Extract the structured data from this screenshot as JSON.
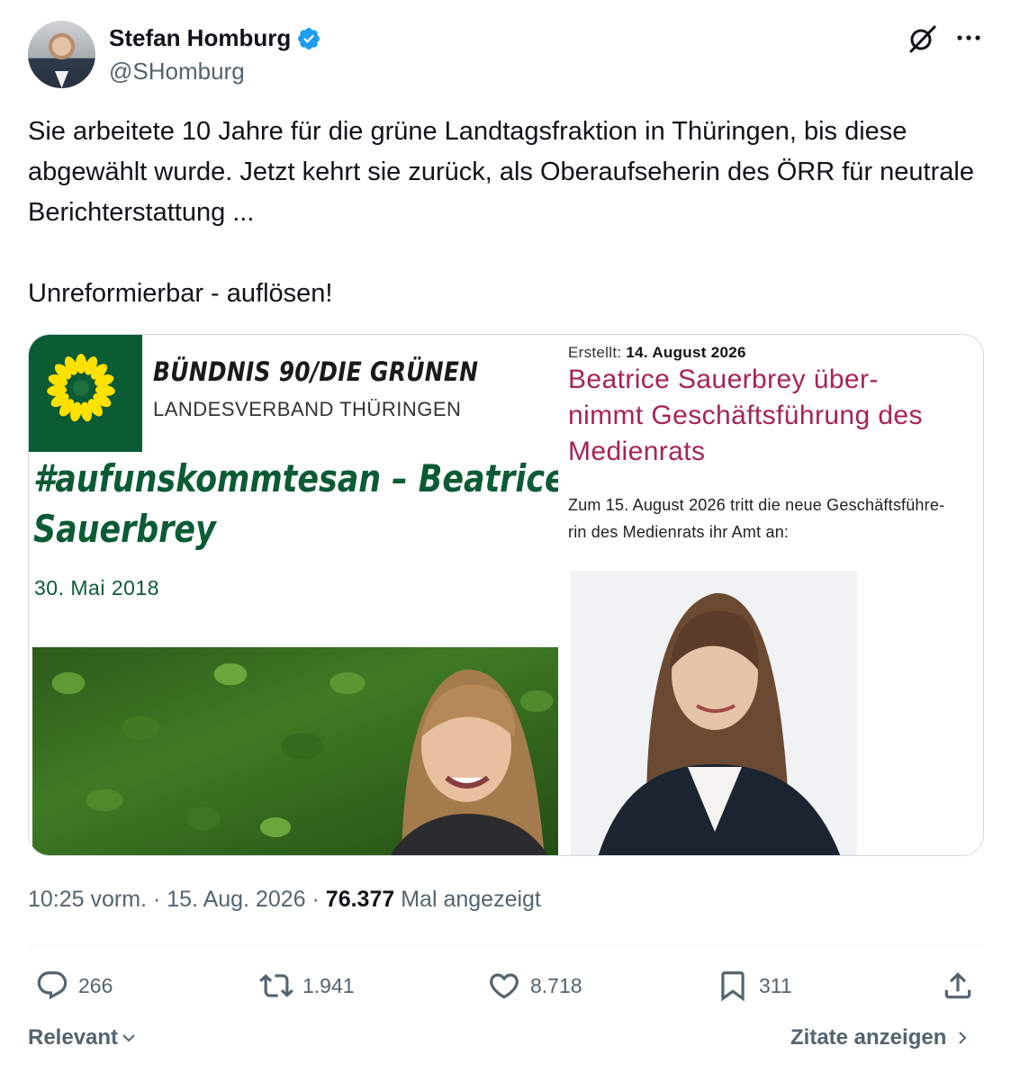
{
  "author": {
    "name": "Stefan Homburg",
    "handle": "@SHomburg",
    "verified": true
  },
  "icons": {
    "verified": "verified-badge-icon",
    "grok": "grok-icon",
    "more": "more-options-icon",
    "reply": "reply-icon",
    "retweet": "retweet-icon",
    "like": "like-icon",
    "bookmark": "bookmark-icon",
    "share": "share-icon"
  },
  "tweet": {
    "paragraph_1": "Sie arbeitete 10 Jahre für die grüne Landtagsfraktion in Thüringen, bis diese abgewählt wurde. Jetzt kehrt sie zurück, als Oberaufseherin des ÖRR für neutrale Berichterstattung ...",
    "paragraph_2": "Unreformierbar - auflösen!"
  },
  "media": {
    "left": {
      "party_name": "BÜNDNIS 90/DIE GRÜNEN",
      "party_sub": "LANDESVERBAND THÜRINGEN",
      "hashtag_line_1": "#aufunskommtesan – Beatrice",
      "hashtag_line_2": "Sauerbrey",
      "date": "30. Mai 2018"
    },
    "right": {
      "created_label": "Erstellt:",
      "created_date": "14. August 2026",
      "headline": "Beatrice Sauerbrey über-\nnimmt Geschäftsführung des\nMedienrats",
      "body": "Zum 15. August 2026 tritt die neue Geschäftsführe-\nrin des Medienrats ihr Amt an:"
    }
  },
  "meta": {
    "time": "10:25 vorm.",
    "separator": "·",
    "date": "15. Aug. 2026",
    "views_count": "76.377",
    "views_label": "Mal angezeigt"
  },
  "actions": {
    "replies": "266",
    "retweets": "1.941",
    "likes": "8.718",
    "bookmarks": "311"
  },
  "footer": {
    "sort_label": "Relevant",
    "quotes_label": "Zitate anzeigen"
  },
  "colors": {
    "text": "#0f1419",
    "secondary": "#536471",
    "verified": "#1d9bf0",
    "green_party": "#0b5b35",
    "headline_magenta": "#a7225a"
  }
}
